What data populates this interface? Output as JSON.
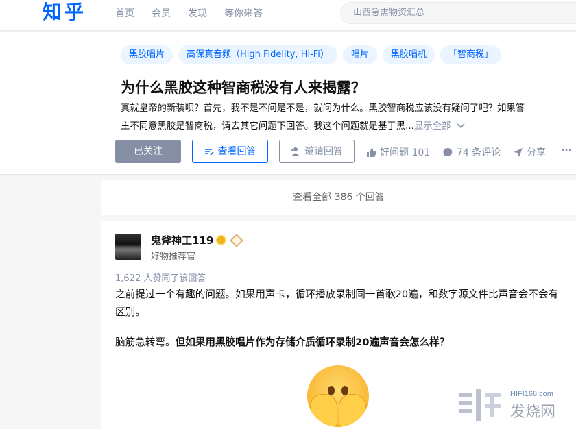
{
  "header": {
    "logo": "知乎",
    "nav": [
      "首页",
      "会员",
      "发现",
      "等你来答"
    ],
    "search_placeholder": "山西急需物资汇总"
  },
  "question": {
    "tags": [
      "黑胶唱片",
      "高保真音频（High Fidelity, Hi-Fi）",
      "唱片",
      "黑胶唱机",
      "「智商税」"
    ],
    "title": "为什么黑胶这种智商税没有人来揭露？",
    "desc_line1": "真就皇帝的新装呗？首先，我不是不问是不是，就问为什么。黑胶智商税应该没有疑问了吧？如果答",
    "desc_line2": "主不同意黑胶是智商税，请去其它问题下回答。我这个问题就是基于黑...",
    "show_all": "显示全部",
    "followed_label": "已关注",
    "view_answers_label": "查看回答",
    "invite_label": "邀请回答",
    "good_question": "好问题 101",
    "comments": "74 条评论",
    "share": "分享",
    "more": "···"
  },
  "view_all": "查看全部 386 个回答",
  "answer": {
    "author": "鬼斧神工119",
    "author_subtitle": "好物推荐官",
    "votes": "1,622 人赞同了该回答",
    "para1": "之前提过一个有趣的问题。如果用声卡，循环播放录制同一首歌20遍，和数字源文件比声音会不会有区别。",
    "para2_normal": "脑筋急转弯。",
    "para2_bold": "但如果用黑胶唱片作为存储介质循环录制20遍声音会怎么样？"
  },
  "watermark": {
    "site": "HIFI168.com",
    "name": "发烧网"
  },
  "colors": {
    "brand": "#0066ff",
    "muted": "#8590a6",
    "tag_bg": "#ebf5ff"
  }
}
